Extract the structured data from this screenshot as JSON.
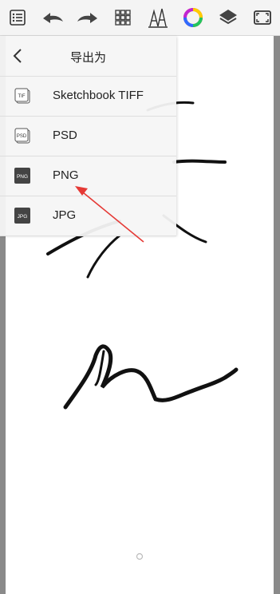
{
  "toolbar": {
    "icons": [
      "list-icon",
      "undo-icon",
      "redo-icon",
      "grid-icon",
      "pen-tools-icon",
      "color-wheel-icon",
      "layers-icon",
      "fullscreen-icon"
    ]
  },
  "export_panel": {
    "title": "导出为",
    "options": [
      {
        "label": "Sketchbook TIFF",
        "badge": "TIF"
      },
      {
        "label": "PSD",
        "badge": "PSD"
      },
      {
        "label": "PNG",
        "badge": "PNG"
      },
      {
        "label": "JPG",
        "badge": "JPG"
      }
    ]
  },
  "colors": {
    "accent_arrow": "#e53935",
    "toolbar_bg": "#f4f4f4",
    "panel_bg": "#f6f6f6"
  }
}
